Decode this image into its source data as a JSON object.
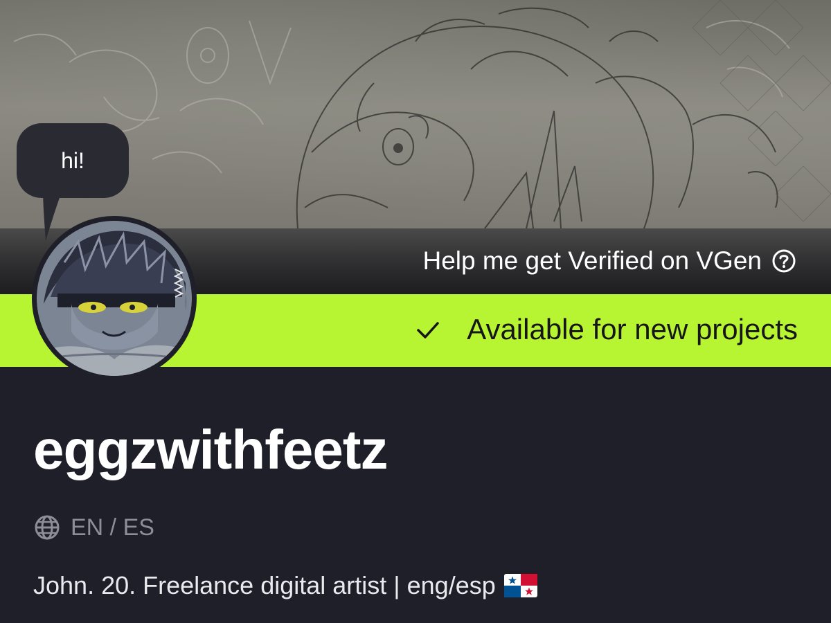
{
  "banner": {
    "verify_label": "Help me get Verified on VGen",
    "status_label": "Available for new projects",
    "status_color": "#b7f432"
  },
  "bubble": {
    "text": "hi!"
  },
  "profile": {
    "username": "eggzwithfeetz",
    "languages": "EN / ES",
    "bio": "John. 20. Freelance digital artist | eng/esp",
    "flag_icon": "panama-flag-icon"
  },
  "icons": {
    "help": "question-circle-icon",
    "check": "check-icon",
    "globe": "globe-icon"
  },
  "colors": {
    "background": "#1f1f2a",
    "accent": "#b7f432"
  }
}
